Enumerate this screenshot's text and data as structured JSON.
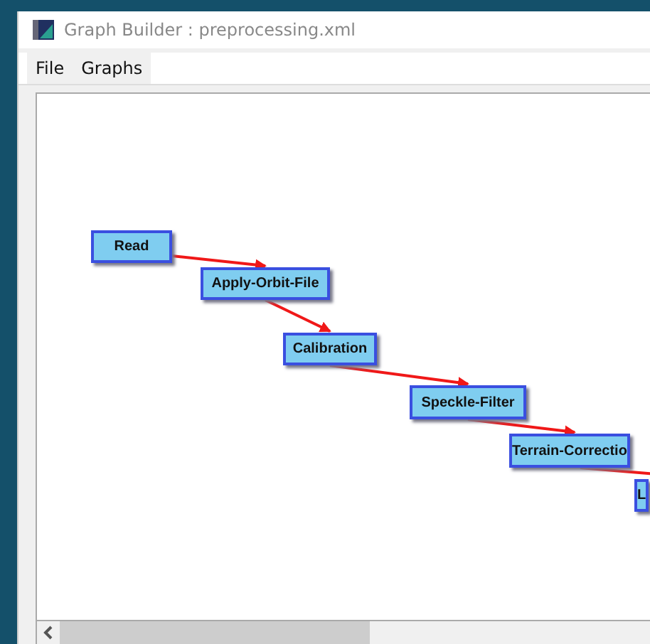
{
  "window": {
    "title": "Graph Builder : preprocessing.xml"
  },
  "menu": [
    "File",
    "Graphs"
  ],
  "graph": {
    "nodes": [
      {
        "label": "Read"
      },
      {
        "label": "Apply-Orbit-File"
      },
      {
        "label": "Calibration"
      },
      {
        "label": "Speckle-Filter"
      },
      {
        "label": "Terrain-Correctio"
      },
      {
        "label": "L"
      }
    ]
  }
}
